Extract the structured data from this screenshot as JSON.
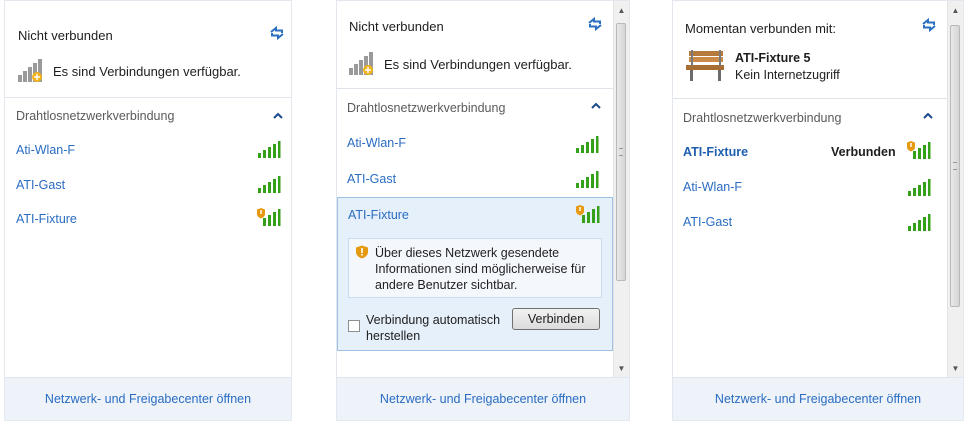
{
  "panel1": {
    "header_title": "Nicht verbunden",
    "status_text": "Es sind Verbindungen verfügbar.",
    "section_label": "Drahtlosnetzwerkverbindung",
    "networks": [
      {
        "name": "Ati-Wlan-F",
        "secured": true
      },
      {
        "name": "ATI-Gast",
        "secured": true
      },
      {
        "name": "ATI-Fixture",
        "secured": false
      }
    ],
    "footer_link": "Netzwerk- und Freigabecenter öffnen"
  },
  "panel2": {
    "header_title": "Nicht verbunden",
    "status_text": "Es sind Verbindungen verfügbar.",
    "section_label": "Drahtlosnetzwerkverbindung",
    "networks": [
      {
        "name": "Ati-Wlan-F",
        "secured": true
      },
      {
        "name": "ATI-Gast",
        "secured": true
      },
      {
        "name": "ATI-Fixture",
        "secured": false
      }
    ],
    "expanded": {
      "warning_text": "Über dieses Netzwerk gesendete Informationen sind möglicherweise für andere Benutzer sichtbar.",
      "checkbox_label": "Verbindung automatisch herstellen",
      "checkbox_checked": false,
      "connect_button": "Verbinden"
    },
    "footer_link": "Netzwerk- und Freigabecenter öffnen"
  },
  "panel3": {
    "header_title": "Momentan verbunden mit:",
    "connected_name": "ATI-Fixture  5",
    "connected_status": "Kein Internetzugriff",
    "section_label": "Drahtlosnetzwerkverbindung",
    "networks": [
      {
        "name": "ATI-Fixture",
        "status": "Verbunden",
        "secured": false
      },
      {
        "name": "Ati-Wlan-F",
        "status": "",
        "secured": true
      },
      {
        "name": "ATI-Gast",
        "status": "",
        "secured": true
      }
    ],
    "footer_link": "Netzwerk- und Freigabecenter öffnen"
  },
  "icons": {
    "refresh": "refresh-icon",
    "signal": "signal-strength-icon",
    "warning_shield": "security-warning-shield-icon",
    "network_status": "network-status-icon",
    "bench": "public-network-bench-icon"
  },
  "colors": {
    "link": "#2a6cc2",
    "signal_green": "#35a11a",
    "warning_orange": "#e69a12",
    "selected_bg": "#e6f0fb",
    "footer_bg": "#eef3f9"
  }
}
